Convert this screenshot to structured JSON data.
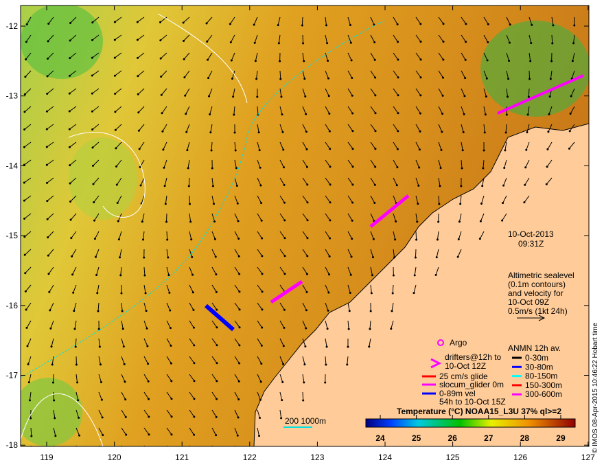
{
  "map": {
    "lon_ticks": [
      "119",
      "120",
      "121",
      "122",
      "123",
      "124",
      "125",
      "126",
      "127"
    ],
    "lat_ticks": [
      "-12",
      "-13",
      "-14",
      "-15",
      "-16",
      "-17",
      "-18"
    ],
    "lon_range": [
      118.6,
      127.0
    ],
    "lat_range": [
      -11.8,
      -18.0
    ]
  },
  "annotation": {
    "date": "10-Oct-2013",
    "time": "09:31Z",
    "altimetry_lines": [
      "Altimetric sealevel",
      "(0.1m contours)",
      "and velocity for",
      "10-Oct 09Z",
      "0.5m/s (1kt 24h)"
    ]
  },
  "legend": {
    "argo": "Argo",
    "drifters": [
      "drifters@12h to",
      "10-Oct 12Z"
    ],
    "glide": "25 cm/s glide",
    "slocum": "slocum_glider 0m",
    "vel": [
      "0-89m vel",
      "54h to 10-Oct 15Z"
    ],
    "anmn_title": "ANMN 12h av.",
    "anmn": [
      {
        "label": "0-30m",
        "color": "#000000"
      },
      {
        "label": "30-80m",
        "color": "#0000ff"
      },
      {
        "label": "80-150m",
        "color": "#00ffff"
      },
      {
        "label": "150-300m",
        "color": "#ff0000"
      },
      {
        "label": "300-600m",
        "color": "#ff00ff"
      }
    ],
    "scale_label": "200  1000m"
  },
  "colorbar": {
    "title": "Temperature (°C) NOAA15_L3U 37% ql>=2",
    "ticks": [
      "24",
      "25",
      "26",
      "27",
      "28",
      "29"
    ],
    "range": [
      23.6,
      29.4
    ]
  },
  "credit": "© IMOS 08-Apr-2015 10:46:22 Hobart time",
  "colors": {
    "land": "#ffcc99",
    "sst_warm": "#d98a1a",
    "sst_mid": "#e8b830",
    "sst_cool": "#b8d840"
  }
}
